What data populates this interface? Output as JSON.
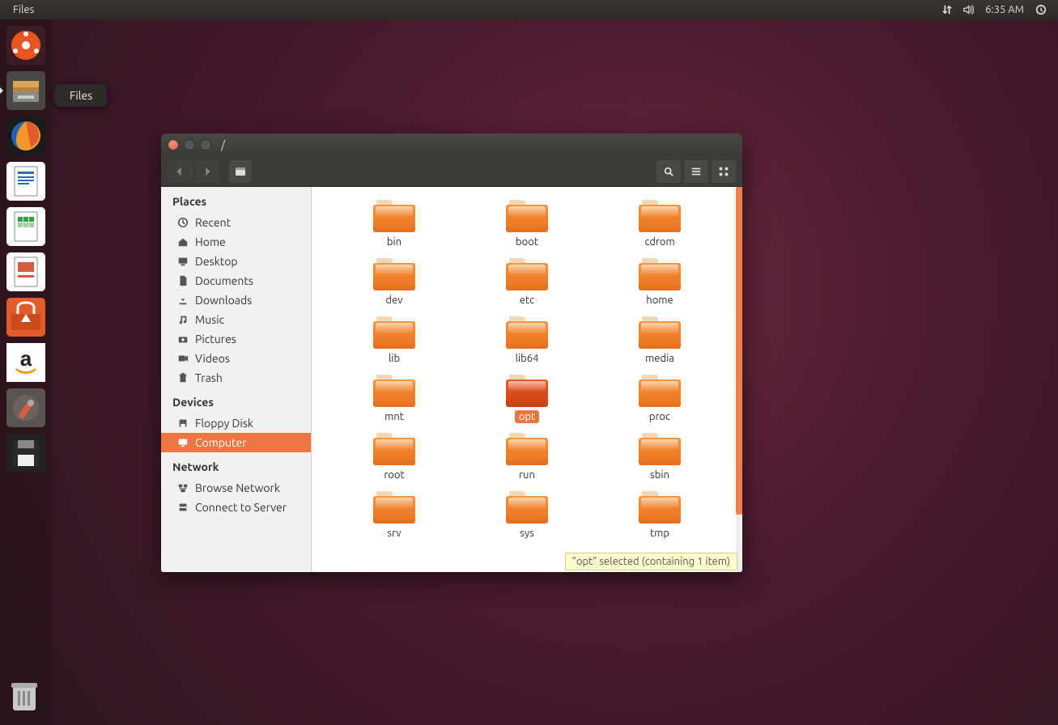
{
  "menubar": {
    "app_label": "Files",
    "time": "6:35 AM"
  },
  "launcher": {
    "tooltip": "Files",
    "items": [
      {
        "name": "dash",
        "bg": "#3b1c27"
      },
      {
        "name": "files",
        "bg": "#4a4844",
        "active": true
      },
      {
        "name": "firefox",
        "bg": "#1a1a1a"
      },
      {
        "name": "writer",
        "bg": "#ffffff"
      },
      {
        "name": "calc",
        "bg": "#ffffff"
      },
      {
        "name": "impress",
        "bg": "#ffffff"
      },
      {
        "name": "software",
        "bg": "#e25b2a"
      },
      {
        "name": "amazon",
        "bg": "#ffffff"
      },
      {
        "name": "settings",
        "bg": "#5a5550"
      },
      {
        "name": "floppy",
        "bg": "#222222"
      }
    ]
  },
  "window": {
    "title": "/",
    "sidebar": {
      "groups": [
        {
          "heading": "Places",
          "items": [
            {
              "label": "Recent",
              "icon": "clock"
            },
            {
              "label": "Home",
              "icon": "home"
            },
            {
              "label": "Desktop",
              "icon": "desktop"
            },
            {
              "label": "Documents",
              "icon": "doc"
            },
            {
              "label": "Downloads",
              "icon": "download"
            },
            {
              "label": "Music",
              "icon": "music"
            },
            {
              "label": "Pictures",
              "icon": "camera"
            },
            {
              "label": "Videos",
              "icon": "video"
            },
            {
              "label": "Trash",
              "icon": "trash"
            }
          ]
        },
        {
          "heading": "Devices",
          "items": [
            {
              "label": "Floppy Disk",
              "icon": "disk"
            },
            {
              "label": "Computer",
              "icon": "computer",
              "selected": true
            }
          ]
        },
        {
          "heading": "Network",
          "items": [
            {
              "label": "Browse Network",
              "icon": "network"
            },
            {
              "label": "Connect to Server",
              "icon": "server"
            }
          ]
        }
      ]
    },
    "folders": [
      {
        "label": "bin"
      },
      {
        "label": "boot"
      },
      {
        "label": "cdrom"
      },
      {
        "label": "dev"
      },
      {
        "label": "etc"
      },
      {
        "label": "home"
      },
      {
        "label": "lib"
      },
      {
        "label": "lib64"
      },
      {
        "label": "media"
      },
      {
        "label": "mnt"
      },
      {
        "label": "opt",
        "selected": true
      },
      {
        "label": "proc"
      },
      {
        "label": "root"
      },
      {
        "label": "run"
      },
      {
        "label": "sbin"
      },
      {
        "label": "srv"
      },
      {
        "label": "sys"
      },
      {
        "label": "tmp"
      }
    ],
    "status": "“opt” selected  (containing 1 item)"
  }
}
